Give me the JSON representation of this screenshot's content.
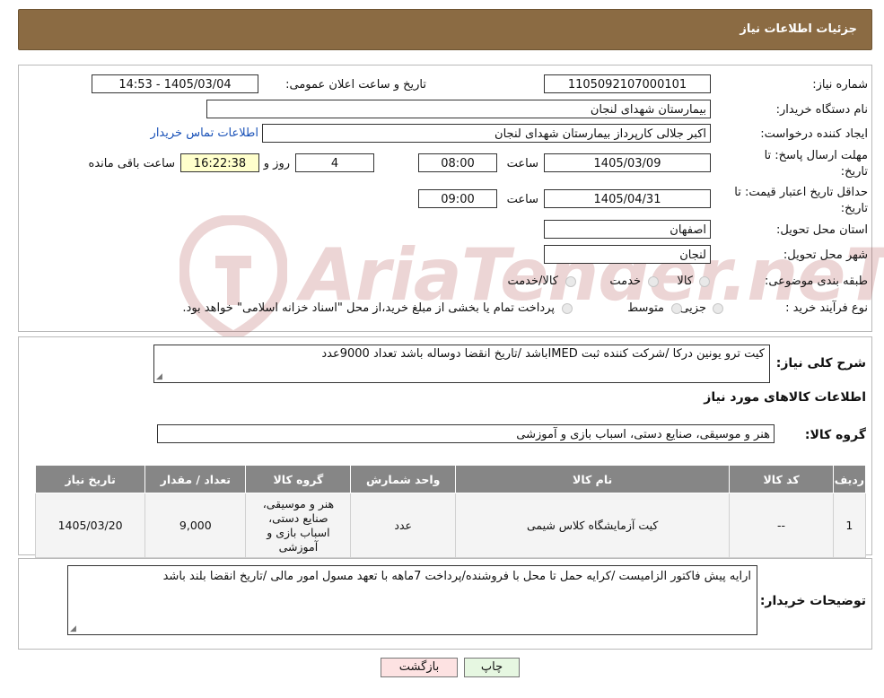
{
  "header": {
    "title": "جزئيات اطلاعات نیاز"
  },
  "fields": {
    "need_number_label": "شماره نیاز:",
    "need_number": "1105092107000101",
    "announce_label": "تاریخ و ساعت اعلان عمومی:",
    "announce_value": "1405/03/04 - 14:53",
    "buyer_org_label": "نام دستگاه خریدار:",
    "buyer_org": "بیمارستان شهدای لنجان",
    "creator_label": "ایجاد کننده درخواست:",
    "creator": "اکبر جلالی کارپرداز بیمارستان شهدای لنجان",
    "contact_link": "اطلاعات تماس خریدار",
    "reply_deadline_label_1": "مهلت ارسال پاسخ: تا",
    "reply_deadline_label_2": "تاریخ:",
    "reply_date": "1405/03/09",
    "time_label": "ساعت",
    "reply_time": "08:00",
    "days_value": "4",
    "days_label": "روز و",
    "remaining_time": "16:22:38",
    "remaining_label": "ساعت باقی مانده",
    "validity_label_1": "حداقل تاریخ اعتبار قیمت: تا",
    "validity_label_2": "تاریخ:",
    "validity_date": "1405/04/31",
    "validity_time": "09:00",
    "province_label": "استان محل تحویل:",
    "province": "اصفهان",
    "city_label": "شهر محل تحویل:",
    "city": "لنجان",
    "category_label": "طبقه بندی موضوعی:",
    "category_options": [
      "کالا",
      "خدمت",
      "کالا/خدمت"
    ],
    "purchase_type_label": "نوع فرآیند خرید :",
    "purchase_options": [
      "جزیی",
      "متوسط"
    ],
    "purchase_note": "پرداخت تمام یا بخشی از مبلغ خرید،از محل \"اسناد خزانه اسلامی\" خواهد بود."
  },
  "summary": {
    "label": "شرح کلی نیاز:",
    "text": "کیت ترو یونین درکا /شرکت کننده ثبت IMEDباشد /تاریخ انقضا دوساله باشد تعداد 9000عدد"
  },
  "goods": {
    "section_title": "اطلاعات کالاهای مورد نیاز",
    "group_label": "گروه کالا:",
    "group_value": "هنر و موسیقی، صنایع دستی، اسباب بازی و آموزشی",
    "columns": [
      "ردیف",
      "کد کالا",
      "نام کالا",
      "واحد شمارش",
      "گروه کالا",
      "تعداد / مقدار",
      "تاریخ نیاز"
    ],
    "rows": [
      [
        "1",
        "--",
        "کیت آزمایشگاه کلاس شیمی",
        "عدد",
        "هنر و موسیقی، صنایع دستی، اسباب بازی و آموزشی",
        "9,000",
        "1405/03/20"
      ]
    ]
  },
  "buyer_notes": {
    "label": "توضیحات خریدار:",
    "text": "ارایه پیش فاکتور الزامیست /کرایه حمل تا محل با فروشنده/پرداخت 7ماهه با تعهد مسول امور مالی /تاریخ انقضا بلند باشد"
  },
  "buttons": {
    "print": "چاپ",
    "back": "بازگشت"
  },
  "watermark": {
    "text": "AriaTender.neT"
  },
  "colors": {
    "header": "#8b6b43",
    "table_header": "#868686",
    "back_button": "#fde2e2",
    "print_button": "#e6f7e1"
  }
}
